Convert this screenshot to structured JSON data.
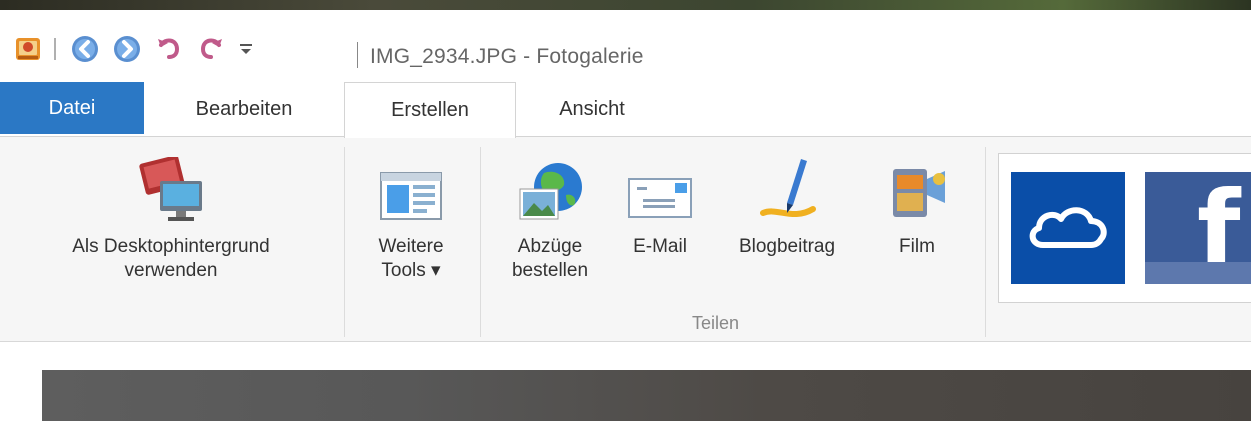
{
  "window": {
    "title": "IMG_2934.JPG - Fotogalerie"
  },
  "quick_access": {
    "icons": [
      "photo-gallery-app-icon",
      "back-icon",
      "forward-icon",
      "undo-icon",
      "redo-icon",
      "customize-dropdown-icon"
    ]
  },
  "tabs": [
    {
      "label": "Datei",
      "selected": false
    },
    {
      "label": "Bearbeiten",
      "selected": false
    },
    {
      "label": "Erstellen",
      "selected": true
    },
    {
      "label": "Ansicht",
      "selected": false
    }
  ],
  "ribbon": {
    "desktop_background": {
      "label": "Als Desktophintergrund\nverwenden",
      "icon": "desktop-background-icon"
    },
    "more_tools": {
      "label": "Weitere\nTools ▾",
      "icon": "tools-window-icon"
    },
    "order_prints": {
      "label": "Abzüge\nbestellen",
      "icon": "globe-prints-icon"
    },
    "email": {
      "label": "E-Mail",
      "icon": "email-icon"
    },
    "blog": {
      "label": "Blogbeitrag",
      "icon": "blog-pen-icon"
    },
    "movie": {
      "label": "Film",
      "icon": "film-icon"
    },
    "share_group_label": "Teilen",
    "share_services": [
      {
        "name": "onedrive-button",
        "icon": "onedrive-cloud-icon",
        "color": "#0a4ea8"
      },
      {
        "name": "facebook-button",
        "icon": "facebook-f-icon",
        "color": "#3a5b98",
        "letter": "f"
      }
    ]
  },
  "colors": {
    "file_tab": "#2b78c5",
    "ribbon_bg": "#f6f6f6"
  }
}
